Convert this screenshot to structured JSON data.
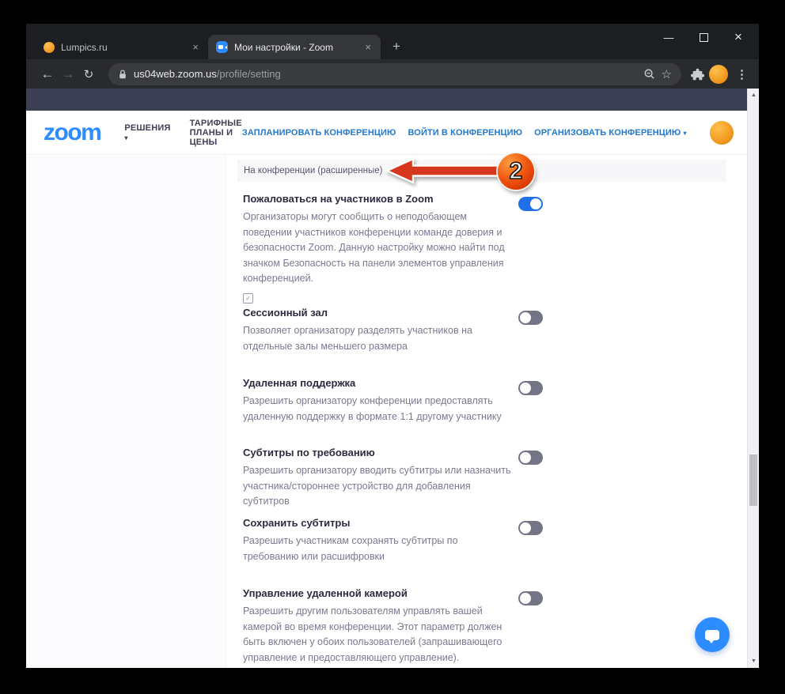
{
  "colors": {
    "accent_blue": "#2D8CFF",
    "link_blue": "#2479CC",
    "toggle_on": "#2170E8",
    "toggle_off": "#747487",
    "banner_slate": "#3D3F54",
    "arrow_red": "#D6371C",
    "badge_orange_red": "#E8430E"
  },
  "icons": {
    "check": "✓",
    "caret_down": "▾",
    "scroll_up": "▲",
    "scroll_down": "▼",
    "back": "←",
    "forward": "→",
    "reload": "↻",
    "star": "☆",
    "menu": "⋮",
    "minimize": "—",
    "close": "×",
    "new_tab": "+",
    "tab_close": "×"
  },
  "browser": {
    "tabs": [
      {
        "title": "Lumpics.ru",
        "favicon": "lumpics-orange-circle",
        "active": false
      },
      {
        "title": "Мои настройки - Zoom",
        "favicon": "zoom-camera",
        "active": true
      }
    ],
    "url": {
      "host": "us04web.zoom.us",
      "path": "/profile/setting"
    }
  },
  "site": {
    "logo": "zoom",
    "nav": [
      {
        "label": "РЕШЕНИЯ",
        "caret": "▾"
      },
      {
        "label": "ТАРИФНЫЕ ПЛАНЫ И ЦЕНЫ",
        "caret": ""
      }
    ],
    "actions": [
      {
        "label": "ЗАПЛАНИРОВАТЬ КОНФЕРЕНЦИЮ",
        "caret": ""
      },
      {
        "label": "ВОЙТИ В КОНФЕРЕНЦИЮ",
        "caret": ""
      },
      {
        "label": "ОРГАНИЗОВАТЬ КОНФЕРЕНЦИЮ",
        "caret": "▾"
      }
    ]
  },
  "annotation": {
    "badge": "2"
  },
  "settings": {
    "section": "На конференции (расширенные)",
    "rows": [
      {
        "title": "Пожаловаться на участников в Zoom",
        "desc": "Организаторы могут сообщить о неподобающем поведении участников конференции команде доверия и безопасности Zoom. Данную настройку можно найти под значком Безопасность на панели элементов управления конференцией.",
        "enabled": true
      },
      {
        "title": "Сессионный зал",
        "desc": "Позволяет организатору разделять участников на отдельные залы меньшего размера",
        "enabled": false
      },
      {
        "title": "Удаленная поддержка",
        "desc": "Разрешить организатору конференции предоставлять удаленную поддержку в формате 1:1 другому участнику",
        "enabled": false
      },
      {
        "title": "Субтитры по требованию",
        "desc": "Разрешить организатору вводить субтитры или назначить участника/стороннее устройство для добавления субтитров",
        "enabled": false
      },
      {
        "title": "Сохранить субтитры",
        "desc": "Разрешить участникам сохранять субтитры по требованию или расшифровки",
        "enabled": false
      },
      {
        "title": "Управление удаленной камерой",
        "desc": "Разрешить другим пользователям управлять вашей камерой во время конференции. Этот параметр должен быть включен у обоих пользователей (запрашивающего управление и предоставляющего управление).",
        "enabled": false
      }
    ]
  }
}
